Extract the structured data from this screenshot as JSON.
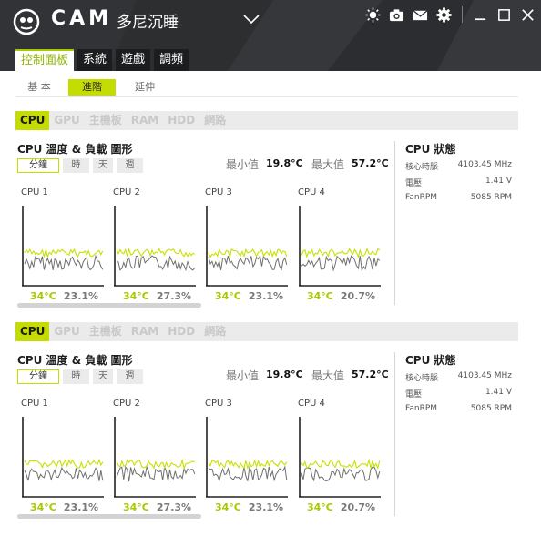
{
  "app": {
    "brand": "CAM",
    "profile": "多尼沉睡"
  },
  "titlebar_icons": [
    "brightness-icon",
    "camera-icon",
    "mail-icon",
    "gear-icon",
    "minimize-icon",
    "maximize-icon",
    "close-icon"
  ],
  "main_tabs": [
    {
      "label": "控制面板",
      "active": true
    },
    {
      "label": "系統",
      "active": false
    },
    {
      "label": "遊戲",
      "active": false
    },
    {
      "label": "調頻",
      "active": false
    }
  ],
  "sub_tabs": [
    {
      "label": "基 本",
      "active": false
    },
    {
      "label": "進階",
      "active": true
    },
    {
      "label": "延伸",
      "active": false
    }
  ],
  "panels": [
    {
      "hw_tabs": [
        {
          "label": "CPU",
          "active": true
        },
        {
          "label": "GPU",
          "active": false
        },
        {
          "label": "主機板",
          "active": false
        },
        {
          "label": "RAM",
          "active": false
        },
        {
          "label": "HDD",
          "active": false
        },
        {
          "label": "網路",
          "active": false
        }
      ],
      "graph_title": "CPU 溫度 & 負載 圖形",
      "time_tabs": [
        {
          "label": "分鐘",
          "active": true
        },
        {
          "label": "時",
          "active": false
        },
        {
          "label": "天",
          "active": false
        },
        {
          "label": "週",
          "active": false
        }
      ],
      "min_label": "最小值",
      "min_value": "19.8°C",
      "max_label": "最大值",
      "max_value": "57.2°C",
      "cores": [
        {
          "label": "CPU 1",
          "temp": "34°C",
          "load": "23.1%"
        },
        {
          "label": "CPU 2",
          "temp": "34°C",
          "load": "27.3%"
        },
        {
          "label": "CPU 3",
          "temp": "34°C",
          "load": "23.1%"
        },
        {
          "label": "CPU 4",
          "temp": "34°C",
          "load": "20.7%"
        }
      ],
      "status_title": "CPU 狀態",
      "status_rows": [
        {
          "label": "核心時脈",
          "value": "4103.45 MHz"
        },
        {
          "label": "電壓",
          "value": "1.41 V"
        },
        {
          "label": "FanRPM",
          "value": "5085 RPM"
        }
      ]
    },
    {
      "hw_tabs": [
        {
          "label": "CPU",
          "active": true
        },
        {
          "label": "GPU",
          "active": false
        },
        {
          "label": "主機板",
          "active": false
        },
        {
          "label": "RAM",
          "active": false
        },
        {
          "label": "HDD",
          "active": false
        },
        {
          "label": "網路",
          "active": false
        }
      ],
      "graph_title": "CPU 溫度 & 負載 圖形",
      "time_tabs": [
        {
          "label": "分鐘",
          "active": true
        },
        {
          "label": "時",
          "active": false
        },
        {
          "label": "天",
          "active": false
        },
        {
          "label": "週",
          "active": false
        }
      ],
      "min_label": "最小值",
      "min_value": "19.8°C",
      "max_label": "最大值",
      "max_value": "57.2°C",
      "cores": [
        {
          "label": "CPU 1",
          "temp": "34°C",
          "load": "23.1%"
        },
        {
          "label": "CPU 2",
          "temp": "34°C",
          "load": "27.3%"
        },
        {
          "label": "CPU 3",
          "temp": "34°C",
          "load": "23.1%"
        },
        {
          "label": "CPU 4",
          "temp": "34°C",
          "load": "20.7%"
        }
      ],
      "status_title": "CPU 狀態",
      "status_rows": [
        {
          "label": "核心時脈",
          "value": "4103.45 MHz"
        },
        {
          "label": "電壓",
          "value": "1.41 V"
        },
        {
          "label": "FanRPM",
          "value": "5085 RPM"
        }
      ]
    }
  ],
  "colors": {
    "accent": "#c5dc00",
    "temp_text": "#a9c800",
    "titlebar_bg": "#2f3133",
    "temp_line": "#c8e000",
    "load_line": "#6f6f6f"
  }
}
